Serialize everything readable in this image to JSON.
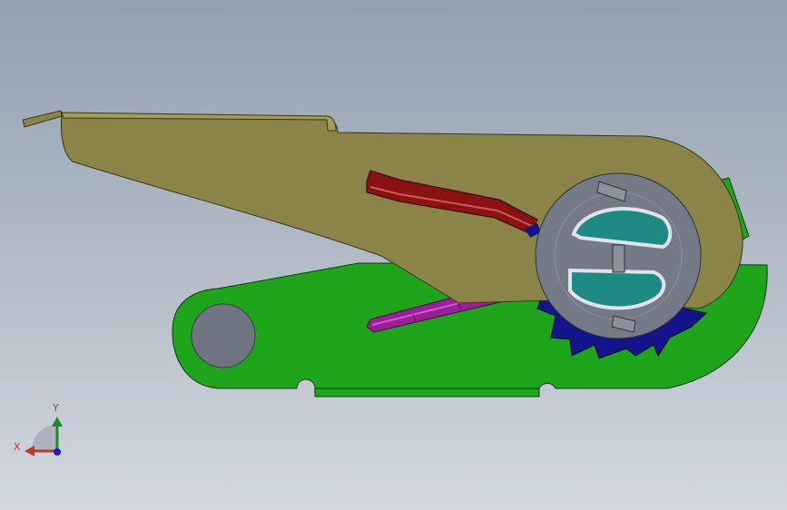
{
  "triad": {
    "x_label": "X",
    "y_label": "Y"
  },
  "colors": {
    "background_top": "#93a0b1",
    "background_bottom": "#d3d8df",
    "handle": "#8b8448",
    "base": "#1fa51c",
    "spring_upper": "#8b1212",
    "spring_lower": "#9b1f9b",
    "spool": "#757b86",
    "spool_window": "#1f8a84",
    "gear": "#14148c",
    "pin": "#6e7480",
    "axis_x": "#c0392b",
    "axis_y": "#1e8a2e",
    "axis_z": "#1a1ad0"
  },
  "icons": {
    "triad": "coordinate-triad-icon"
  }
}
